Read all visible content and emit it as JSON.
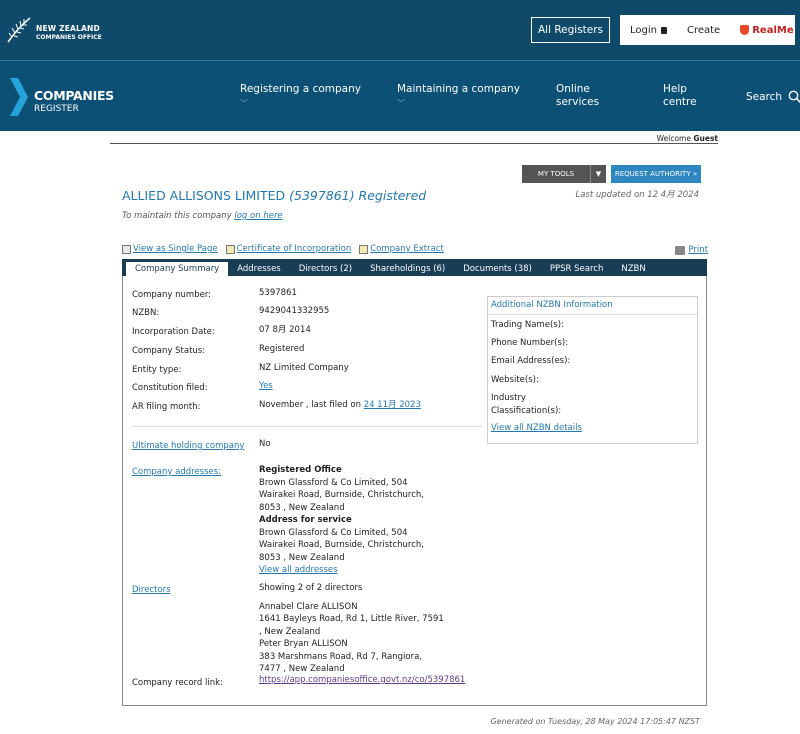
{
  "header": {
    "nz_logo_line1": "NEW ZEALAND",
    "nz_logo_line2": "COMPANIES OFFICE",
    "all_registers": "All Registers",
    "login": "Login",
    "create": "Create",
    "realme": "RealMe"
  },
  "nav": {
    "logo_line1": "COMPANIES",
    "logo_line2": "REGISTER",
    "items": [
      {
        "label": "Registering a company"
      },
      {
        "label": "Maintaining a company"
      },
      {
        "label1": "Online",
        "label2": "services"
      },
      {
        "label1": "Help",
        "label2": "centre"
      }
    ],
    "search": "Search"
  },
  "welcome": {
    "prefix": "Welcome",
    "user": "Guest"
  },
  "tools": {
    "my_tools": "MY TOOLS",
    "request_authority": "REQUEST AUTHORITY »"
  },
  "company": {
    "name": "ALLIED ALLISONS LIMITED",
    "status_suffix": "(5397861) Registered",
    "last_updated": "Last updated on 12 4月 2024",
    "maintain_prefix": "To maintain this company",
    "maintain_link": "log on here"
  },
  "links": {
    "single_page": "View as Single Page",
    "certificate": "Certificate of Incorporation",
    "extract": "Company Extract",
    "print": "Print"
  },
  "tabs": [
    "Company Summary",
    "Addresses",
    "Directors (2)",
    "Shareholdings (6)",
    "Documents (38)",
    "PPSR Search",
    "NZBN"
  ],
  "summary": {
    "company_number_label": "Company number:",
    "company_number": "5397861",
    "nzbn_label": "NZBN:",
    "nzbn": "9429041332955",
    "incorporation_label": "Incorporation Date:",
    "incorporation": "07 8月 2014",
    "status_label": "Company Status:",
    "status": "Registered",
    "entity_label": "Entity type:",
    "entity": "NZ Limited Company",
    "constitution_label": "Constitution filed:",
    "constitution": "Yes",
    "ar_label": "AR filing month:",
    "ar_prefix": "November , last filed on",
    "ar_date": "24 11月 2023",
    "ultimate_label": "Ultimate holding company",
    "ultimate": "No",
    "addresses_label": "Company addresses:",
    "registered_office_label": "Registered Office",
    "registered_office": "Brown Glassford & Co Limited, 504 Wairakei Road, Burnside, Christchurch, 8053 , New Zealand",
    "service_label": "Address for service",
    "service": "Brown Glassford & Co Limited, 504 Wairakei Road, Burnside, Christchurch, 8053 , New Zealand",
    "view_addresses": "View all addresses",
    "directors_label": "Directors",
    "directors_count": "Showing 2 of 2 directors",
    "director1_name": "Annabel Clare ALLISON",
    "director1_addr": "1641 Bayleys Road, Rd 1, Little River, 7591 , New Zealand",
    "director2_name": "Peter Bryan ALLISON",
    "director2_addr": "383 Marshmans Road, Rd 7, Rangiora, 7477 , New Zealand",
    "record_label": "Company record link:",
    "record_link": "https://app.companiesoffice.govt.nz/co/5397861"
  },
  "nzbn_info": {
    "heading": "Additional NZBN Information",
    "trading": "Trading Name(s):",
    "phone": "Phone Number(s):",
    "email": "Email Address(es):",
    "website": "Website(s):",
    "industry": "Industry Classification(s):",
    "view_all": "View all NZBN details"
  },
  "footer": {
    "generated": "Generated on Tuesday, 28 May 2024 17:05:47 NZST"
  }
}
